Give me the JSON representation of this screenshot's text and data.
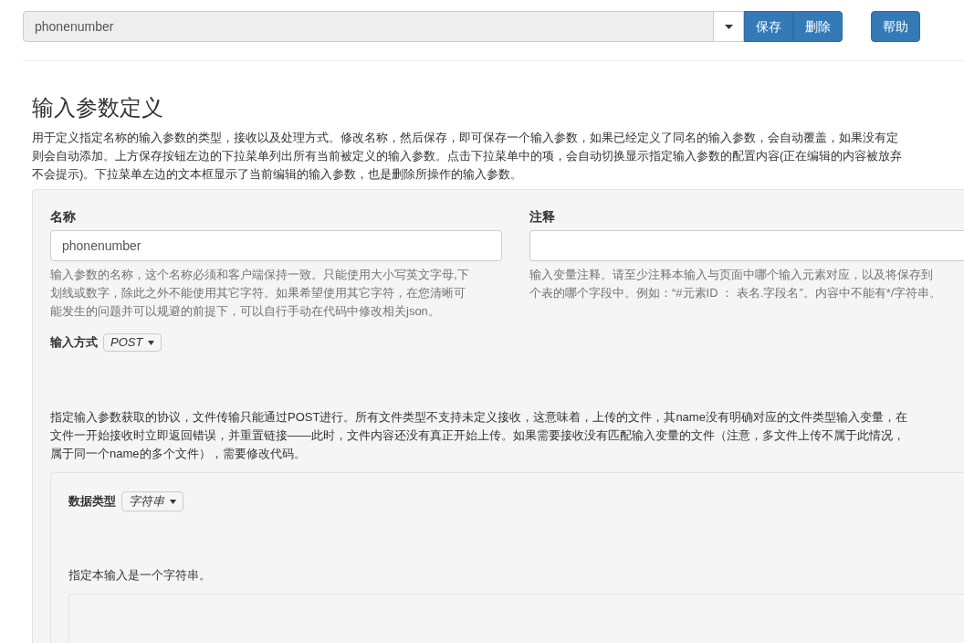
{
  "toolbar": {
    "name_value": "phonenumber",
    "buttons": [
      {
        "label": "保存",
        "kind": "group"
      },
      {
        "label": "删除",
        "kind": "group"
      },
      {
        "label": "帮助",
        "kind": "single"
      }
    ]
  },
  "heading": "输入参数定义",
  "description": [
    "用于定义指定名称的输入参数的类型，接收以及处理方式。修改名称，然后保存，即可保存一个输入参数，如果已经定义了同名的输入参数，会自动覆盖，如果没有定",
    "则会自动添加。上方保存按钮左边的下拉菜单列出所有当前被定义的输入参数。点击下拉菜单中的项，会自动切换显示指定输入参数的配置内容(正在编辑的内容被放弃",
    "不会提示)。下拉菜单左边的文本框显示了当前编辑的输入参数，也是删除所操作的输入参数。"
  ],
  "name_field": {
    "label": "名称",
    "value": "phonenumber",
    "help": [
      "输入参数的名称，这个名称必须和客户端保持一致。只能使用大小写英文字母,下",
      "划线或数字，除此之外不能使用其它字符。如果希望使用其它字符，在您清晰可",
      "能发生的问题并可以规避的前提下，可以自行手动在代码中修改相关json。"
    ]
  },
  "comment_field": {
    "label": "注释",
    "help": [
      "输入变量注释。请至少注释本输入与页面中哪个输入元素对应，以及将保存到",
      "个表的哪个字段中。例如：“#元素ID ： 表名.字段名”。内容中不能有*/字符串。"
    ]
  },
  "input_method": {
    "label": "输入方式",
    "value": "POST"
  },
  "method_description": [
    "指定输入参数获取的协议，文件传输只能通过POST进行。所有文件类型不支持未定义接收，这意味着，上传的文件，其name没有明确对应的文件类型输入变量，在",
    "文件一开始接收时立即返回错误，并重置链接——此时，文件内容还没有真正开始上传。如果需要接收没有匹配输入变量的文件（注意，多文件上传不属于此情况，",
    "属于同一个name的多个文件），需要修改代码。"
  ],
  "data_type": {
    "label": "数据类型",
    "value": "字符串",
    "description": "指定本输入是一个字符串。"
  }
}
